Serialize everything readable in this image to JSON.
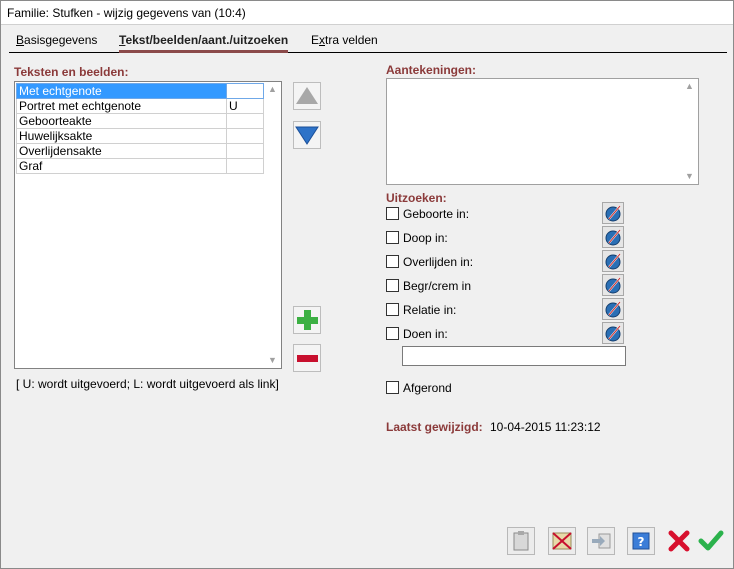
{
  "window": {
    "title": "Familie: Stufken - wijzig gegevens van (10:4)"
  },
  "tabs": [
    {
      "label_pre": "",
      "label_u": "B",
      "label_post": "asisgegevens"
    },
    {
      "label_pre": "",
      "label_u": "T",
      "label_post": "ekst/beelden/aant./uitzoeken"
    },
    {
      "label_pre": "E",
      "label_u": "x",
      "label_post": "tra velden"
    }
  ],
  "texts": {
    "label": "Teksten en beelden:",
    "rows": [
      {
        "name": "Met echtgenote",
        "flag": ""
      },
      {
        "name": "Portret met echtgenote",
        "flag": "U"
      },
      {
        "name": "Geboorteakte",
        "flag": ""
      },
      {
        "name": "Huwelijksakte",
        "flag": ""
      },
      {
        "name": "Overlijdensakte",
        "flag": ""
      },
      {
        "name": "Graf",
        "flag": ""
      }
    ],
    "legend": "[ U: wordt uitgevoerd; L: wordt uitgevoerd als link]"
  },
  "notes": {
    "label": "Aantekeningen:",
    "value": ""
  },
  "research": {
    "label": "Uitzoeken:",
    "items": [
      {
        "label": "Geboorte in:"
      },
      {
        "label": "Doop in:"
      },
      {
        "label": "Overlijden in:"
      },
      {
        "label": "Begr/crem in"
      },
      {
        "label": "Relatie in:"
      },
      {
        "label": "Doen in:"
      }
    ],
    "todo_value": "",
    "completed_label": "Afgerond"
  },
  "last_modified": {
    "label": "Laatst gewijzigd:",
    "value": "10-04-2015 11:23:12"
  },
  "colors": {
    "accent": "#8b3a3a",
    "selection": "#3399ff"
  }
}
